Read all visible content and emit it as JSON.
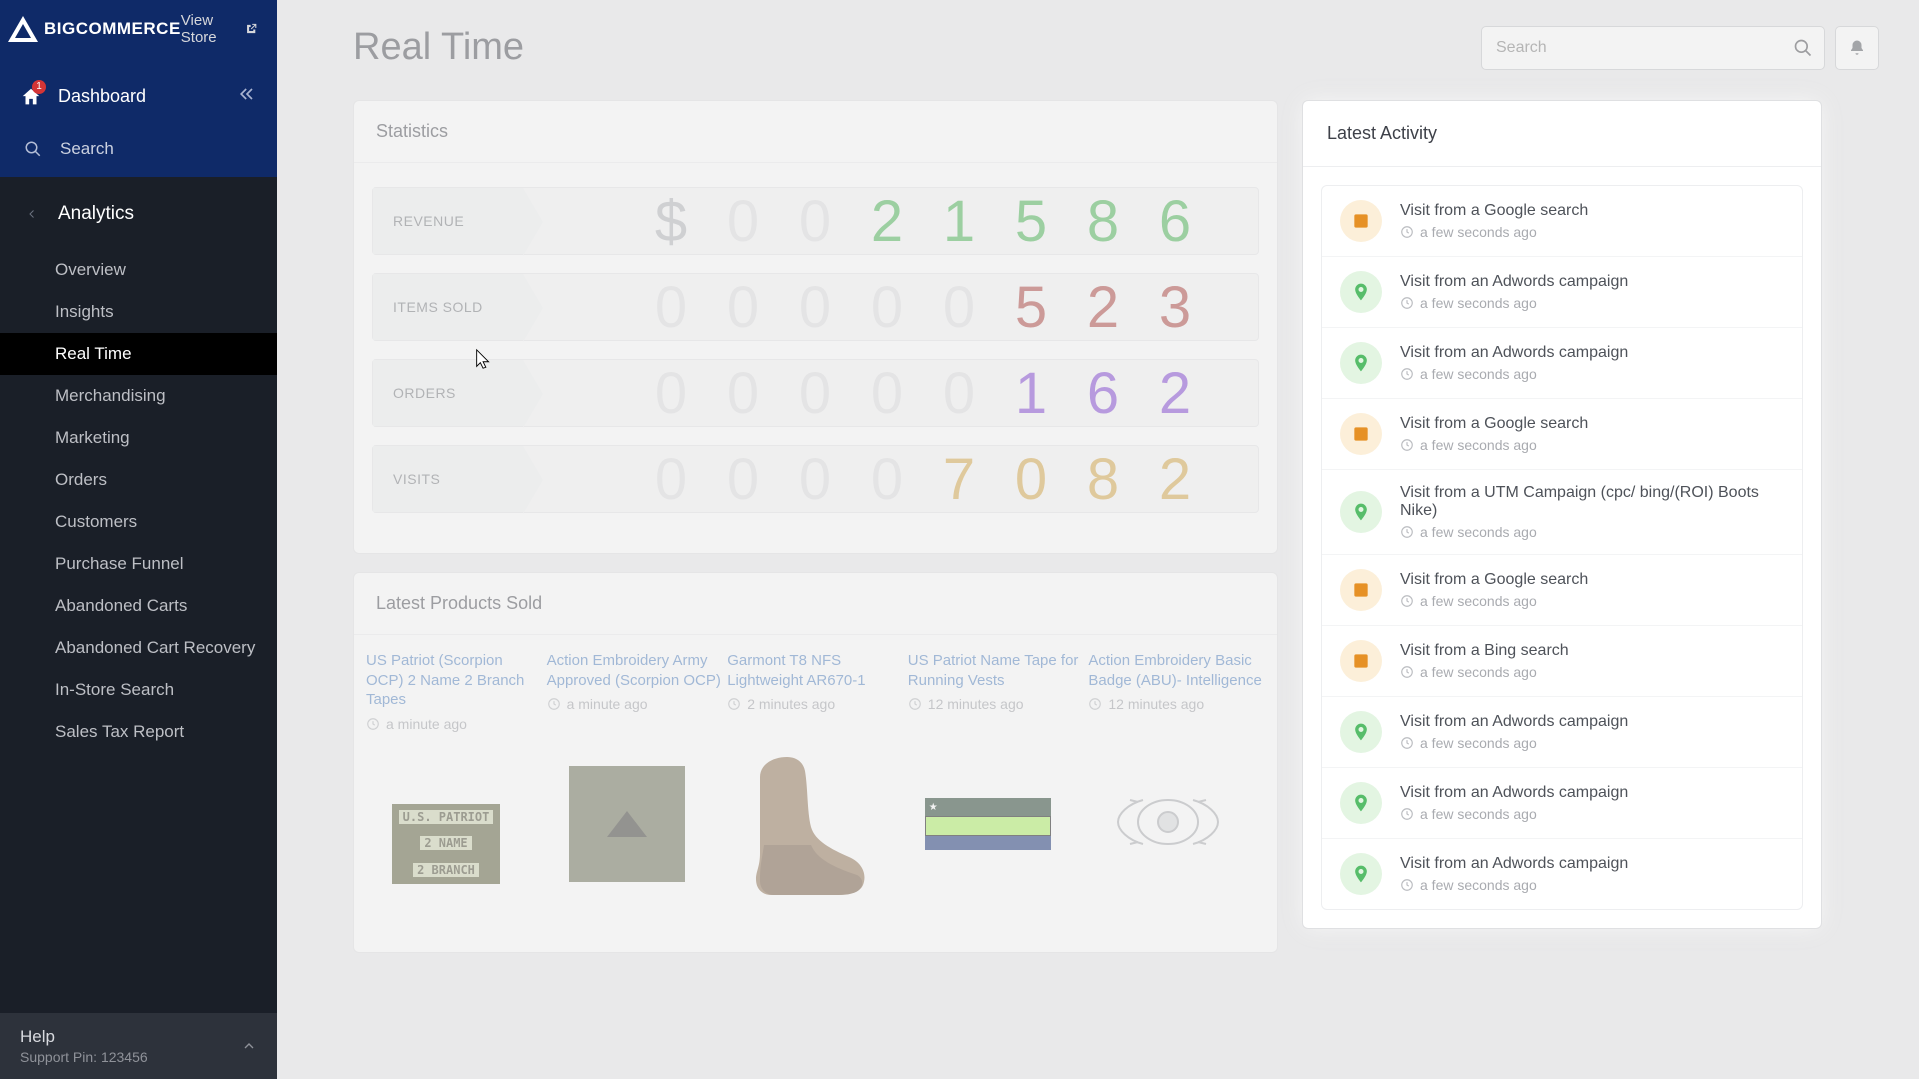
{
  "brand": {
    "name": "BIGCOMMERCE",
    "view_store": "View Store"
  },
  "sidebar": {
    "dashboard": "Dashboard",
    "badge": "1",
    "search": "Search",
    "section": "Analytics",
    "items": [
      {
        "label": "Overview"
      },
      {
        "label": "Insights"
      },
      {
        "label": "Real Time"
      },
      {
        "label": "Merchandising"
      },
      {
        "label": "Marketing"
      },
      {
        "label": "Orders"
      },
      {
        "label": "Customers"
      },
      {
        "label": "Purchase Funnel"
      },
      {
        "label": "Abandoned Carts"
      },
      {
        "label": "Abandoned Cart Recovery"
      },
      {
        "label": "In-Store Search"
      },
      {
        "label": "Sales Tax Report"
      }
    ],
    "help": "Help",
    "support_pin": "Support Pin: 123456"
  },
  "page": {
    "title": "Real Time"
  },
  "search": {
    "placeholder": "Search"
  },
  "statistics": {
    "title": "Statistics",
    "rows": [
      {
        "label": "REVENUE",
        "prefix": "$",
        "leading": "00",
        "value": "21586",
        "color": "green"
      },
      {
        "label": "ITEMS SOLD",
        "prefix": "",
        "leading": "00000",
        "value": "523",
        "color": "darkred"
      },
      {
        "label": "ORDERS",
        "prefix": "",
        "leading": "00000",
        "value": "162",
        "color": "purple"
      },
      {
        "label": "VISITS",
        "prefix": "",
        "leading": "0000",
        "value": "7082",
        "color": "gold"
      }
    ]
  },
  "products": {
    "title": "Latest Products Sold",
    "items": [
      {
        "title": "US Patriot (Scorpion OCP) 2 Name 2 Branch Tapes",
        "time": "a minute ago"
      },
      {
        "title": "Action Embroidery Army Approved (Scorpion OCP)",
        "time": "a minute ago"
      },
      {
        "title": "Garmont T8 NFS Lightweight AR670-1",
        "time": "2 minutes ago"
      },
      {
        "title": "US Patriot Name Tape for Running Vests",
        "time": "12 minutes ago"
      },
      {
        "title": "Action Embroidery Basic Badge (ABU)- Intelligence",
        "time": "12 minutes ago"
      }
    ]
  },
  "activity": {
    "title": "Latest Activity",
    "time": "a few seconds ago",
    "items": [
      {
        "text": "Visit from a Google search",
        "icon": "orange"
      },
      {
        "text": "Visit from an Adwords campaign",
        "icon": "green"
      },
      {
        "text": "Visit from an Adwords campaign",
        "icon": "green"
      },
      {
        "text": "Visit from a Google search",
        "icon": "orange"
      },
      {
        "text": "Visit from a UTM Campaign (cpc/ bing/(ROI) Boots Nike)",
        "icon": "green"
      },
      {
        "text": "Visit from a Google search",
        "icon": "orange"
      },
      {
        "text": "Visit from a Bing search",
        "icon": "orange"
      },
      {
        "text": "Visit from an Adwords campaign",
        "icon": "green"
      },
      {
        "text": "Visit from an Adwords campaign",
        "icon": "green"
      },
      {
        "text": "Visit from an Adwords campaign",
        "icon": "green"
      }
    ]
  },
  "img1": {
    "l1": "U.S. PATRIOT",
    "l2": "2 NAME",
    "l3": "2 BRANCH"
  }
}
